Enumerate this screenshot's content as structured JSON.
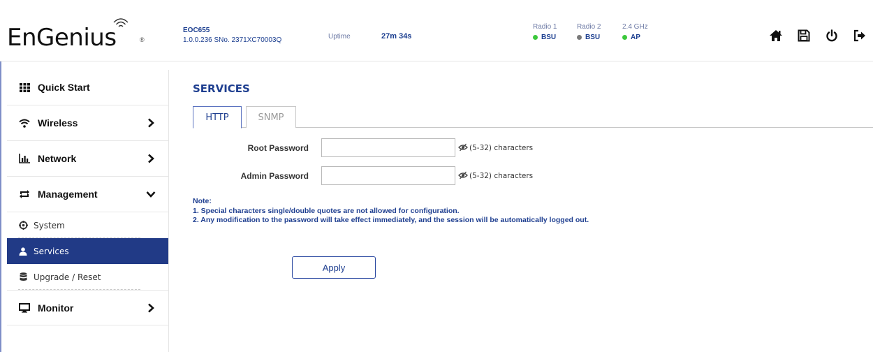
{
  "header": {
    "logo_text": "EnGenius",
    "logo_mark": "®",
    "device_model": "EOC655",
    "firmware_line": "1.0.0.236 SNo. 2371XC70003Q",
    "uptime_label": "Uptime",
    "uptime_value": "27m 34s",
    "radios": [
      {
        "label": "Radio 1",
        "value": "BSU",
        "status_color": "#3cc83c"
      },
      {
        "label": "Radio 2",
        "value": "BSU",
        "status_color": "#7a7a7a"
      },
      {
        "label": "2.4 GHz",
        "value": "AP",
        "status_color": "#3cc83c"
      }
    ],
    "icons": [
      "home-icon",
      "save-icon",
      "power-icon",
      "logout-icon"
    ]
  },
  "sidebar": {
    "items": [
      {
        "label": "Quick Start",
        "icon": "grid-icon"
      },
      {
        "label": "Wireless",
        "icon": "wifi-icon",
        "chevron": "right"
      },
      {
        "label": "Network",
        "icon": "bar-chart-icon",
        "chevron": "right"
      },
      {
        "label": "Management",
        "icon": "management-icon",
        "chevron": "down"
      },
      {
        "label": "Monitor",
        "icon": "monitor-icon",
        "chevron": "right"
      }
    ],
    "subitems": [
      {
        "label": "System",
        "icon": "gear-icon"
      },
      {
        "label": "Services",
        "icon": "user-icon",
        "active": true
      },
      {
        "label": "Upgrade / Reset",
        "icon": "database-icon"
      }
    ]
  },
  "main": {
    "title": "SERVICES",
    "tabs": [
      {
        "label": "HTTP",
        "active": true
      },
      {
        "label": "SNMP",
        "active": false
      }
    ],
    "fields": [
      {
        "label": "Root Password",
        "value": "",
        "hint": "(5-32) characters"
      },
      {
        "label": "Admin Password",
        "value": "",
        "hint": "(5-32) characters"
      }
    ],
    "note_title": "Note:",
    "notes": [
      "1. Special characters single/double quotes are not allowed for configuration.",
      "2. Any modification to the password will take effect immediately, and the session will be automatically logged out."
    ],
    "apply_label": "Apply"
  },
  "colors": {
    "brand_blue": "#1f3f90",
    "active_nav": "#213a86",
    "status_green": "#3cc83c",
    "status_gray": "#7a7a7a"
  }
}
